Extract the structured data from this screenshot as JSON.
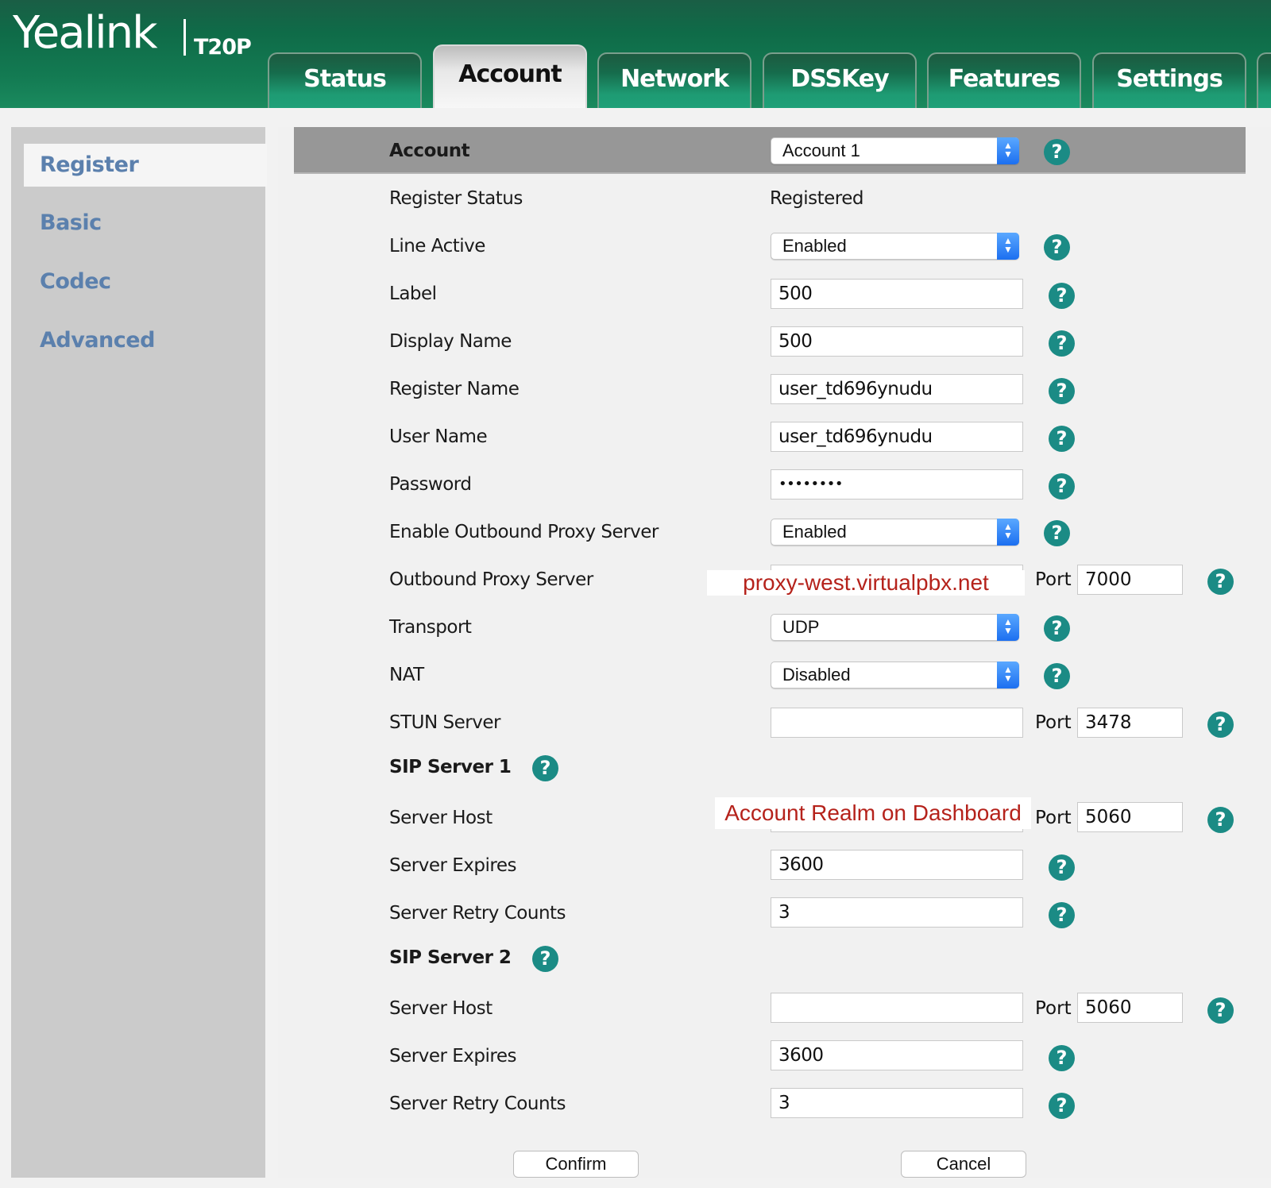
{
  "brand": {
    "logo": "Yealink",
    "model": "T20P"
  },
  "tabs": [
    {
      "label": "Status",
      "active": false
    },
    {
      "label": "Account",
      "active": true
    },
    {
      "label": "Network",
      "active": false
    },
    {
      "label": "DSSKey",
      "active": false
    },
    {
      "label": "Features",
      "active": false
    },
    {
      "label": "Settings",
      "active": false
    }
  ],
  "sidebar": {
    "items": [
      {
        "label": "Register",
        "active": true
      },
      {
        "label": "Basic",
        "active": false
      },
      {
        "label": "Codec",
        "active": false
      },
      {
        "label": "Advanced",
        "active": false
      }
    ]
  },
  "form": {
    "account": {
      "label": "Account",
      "value": "Account 1"
    },
    "register_status": {
      "label": "Register Status",
      "value": "Registered"
    },
    "line_active": {
      "label": "Line Active",
      "value": "Enabled"
    },
    "label_field": {
      "label": "Label",
      "value": "500"
    },
    "display_name": {
      "label": "Display Name",
      "value": "500"
    },
    "register_name": {
      "label": "Register Name",
      "value": "user_td696ynudu"
    },
    "user_name": {
      "label": "User Name",
      "value": "user_td696ynudu"
    },
    "password": {
      "label": "Password",
      "value": "••••••••"
    },
    "enable_outbound_proxy": {
      "label": "Enable Outbound Proxy Server",
      "value": "Enabled"
    },
    "outbound_proxy": {
      "label": "Outbound Proxy Server",
      "value": "",
      "port_label": "Port",
      "port": "7000",
      "annotation": "proxy-west.virtualpbx.net"
    },
    "transport": {
      "label": "Transport",
      "value": "UDP"
    },
    "nat": {
      "label": "NAT",
      "value": "Disabled"
    },
    "stun_server": {
      "label": "STUN Server",
      "value": "",
      "port_label": "Port",
      "port": "3478"
    },
    "sip_server_1": {
      "heading": "SIP Server 1",
      "server_host": {
        "label": "Server Host",
        "value": "",
        "port_label": "Port",
        "port": "5060",
        "annotation": "Account Realm on Dashboard"
      },
      "server_expires": {
        "label": "Server Expires",
        "value": "3600"
      },
      "server_retry_counts": {
        "label": "Server Retry Counts",
        "value": "3"
      }
    },
    "sip_server_2": {
      "heading": "SIP Server 2",
      "server_host": {
        "label": "Server Host",
        "value": "",
        "port_label": "Port",
        "port": "5060"
      },
      "server_expires": {
        "label": "Server Expires",
        "value": "3600"
      },
      "server_retry_counts": {
        "label": "Server Retry Counts",
        "value": "3"
      }
    }
  },
  "buttons": {
    "confirm": "Confirm",
    "cancel": "Cancel"
  },
  "icons": {
    "help": "?",
    "select_arrows": "⌃⌄"
  },
  "colors": {
    "header_green": "#0f6b48",
    "tab_green": "#1fa078",
    "sidebar_link": "#5b80ad",
    "help_teal": "#1b8b85",
    "annotation_red": "#b5221b",
    "select_blue": "#1c6ff0"
  }
}
